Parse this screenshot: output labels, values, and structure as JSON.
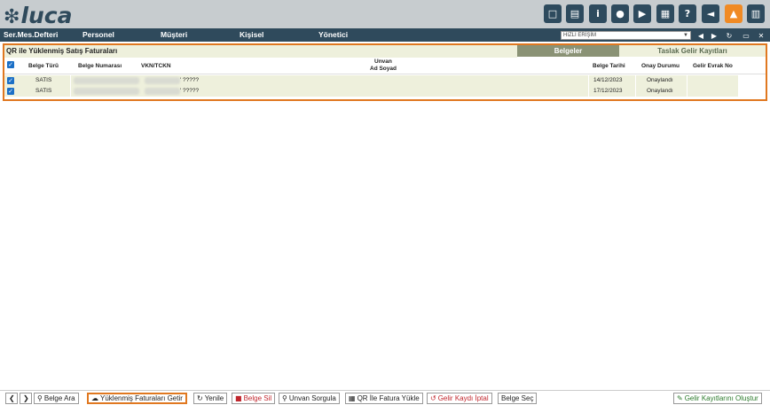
{
  "app": {
    "logo": "luca",
    "logo_mark": "❇"
  },
  "toolbar_icons": [
    {
      "name": "note-icon",
      "glyph": "□"
    },
    {
      "name": "book-icon",
      "glyph": "▤"
    },
    {
      "name": "info-icon",
      "glyph": "i"
    },
    {
      "name": "globe-icon",
      "glyph": "●"
    },
    {
      "name": "youtube-icon",
      "glyph": "▶"
    },
    {
      "name": "calculator-icon",
      "glyph": "▦"
    },
    {
      "name": "help-icon",
      "glyph": "?"
    },
    {
      "name": "megaphone-icon",
      "glyph": "◄"
    },
    {
      "name": "bell-icon",
      "glyph": "▲"
    },
    {
      "name": "manual-icon",
      "glyph": "▥"
    }
  ],
  "menu": {
    "items": [
      "Ser.Mes.Defteri",
      "Personel",
      "Müşteri",
      "Kişisel",
      "Yönetici"
    ],
    "quick_access": "HIZLI ERİŞİM",
    "nav_icons": [
      "◀",
      "▶",
      "↻",
      "▭",
      "✕"
    ]
  },
  "panel": {
    "title": "QR ile Yüklenmiş Satış Faturaları",
    "tab_active": "Belgeler",
    "tab_other": "Taslak Gelir Kayıtları"
  },
  "grid": {
    "headers": {
      "type": "Belge Türü",
      "number": "Belge Numarası",
      "vkn": "VKN/TCKN",
      "title1": "Unvan",
      "title2": "Ad Soyad",
      "date": "Belge Tarihi",
      "status": "Onay Durumu",
      "doc_no": "Gelir Evrak No"
    },
    "rows": [
      {
        "type": "SATIS",
        "name": "?????",
        "date": "14/12/2023",
        "status": "Onaylandı",
        "doc_no": ""
      },
      {
        "type": "SATIS",
        "name": "?????",
        "date": "17/12/2023",
        "status": "Onaylandı",
        "doc_no": ""
      }
    ]
  },
  "bottom": {
    "prev": "❮",
    "next": "❯",
    "belge_ara": "Belge Ara",
    "getir": "Yüklenmiş Faturaları Getir",
    "yenile": "Yenile",
    "belge_sil": "Belge Sil",
    "unvan_sorgula": "Unvan Sorgula",
    "qr_yukle": "QR İle Fatura Yükle",
    "iptal": "Gelir Kaydı İptal",
    "belge_sec": "Belge Seç",
    "olustur": "Gelir Kayıtlarını Oluştur"
  },
  "colors": {
    "accent": "#e07820",
    "header": "#2f4a5c",
    "row": "#eef0dc",
    "tab": "#8a9275",
    "checkbox": "#1b6fc6"
  }
}
